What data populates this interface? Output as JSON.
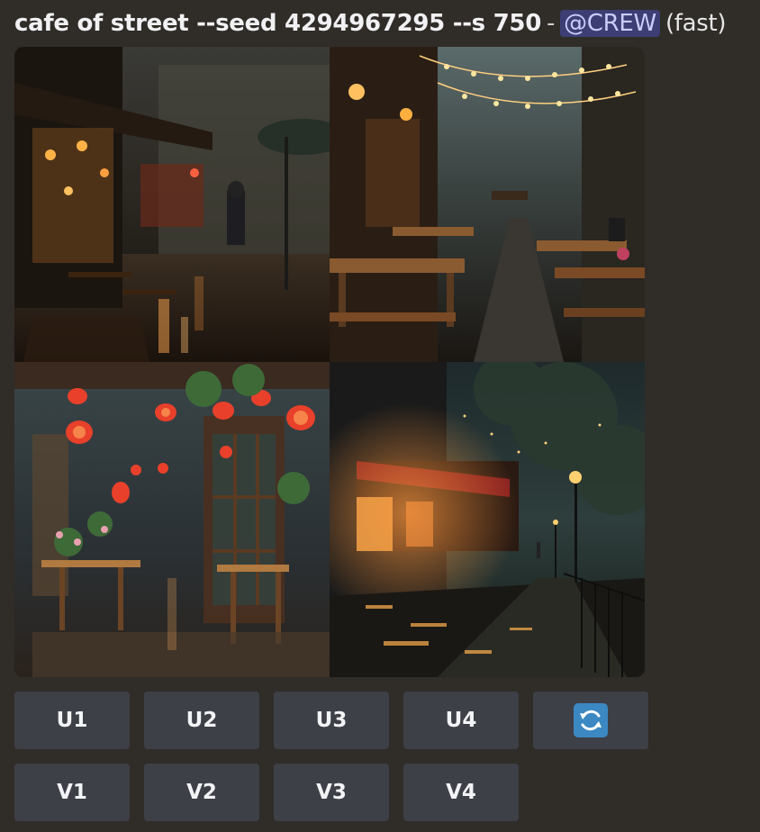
{
  "message": {
    "prompt": "cafe of street --seed 4294967295 --s 750",
    "separator": "-",
    "mention": "@CREW",
    "speed": "(fast)"
  },
  "image_grid": {
    "tiles": [
      {
        "label": "rainy cafe street"
      },
      {
        "label": "alley with picnic tables and string lights"
      },
      {
        "label": "lantern cafe painting"
      },
      {
        "label": "night street cafe painting"
      }
    ]
  },
  "buttons": {
    "upscale": [
      "U1",
      "U2",
      "U3",
      "U4"
    ],
    "variation": [
      "V1",
      "V2",
      "V3",
      "V4"
    ],
    "reroll_icon": "counterclockwise-arrows-icon",
    "accent": "#3b88c3"
  }
}
